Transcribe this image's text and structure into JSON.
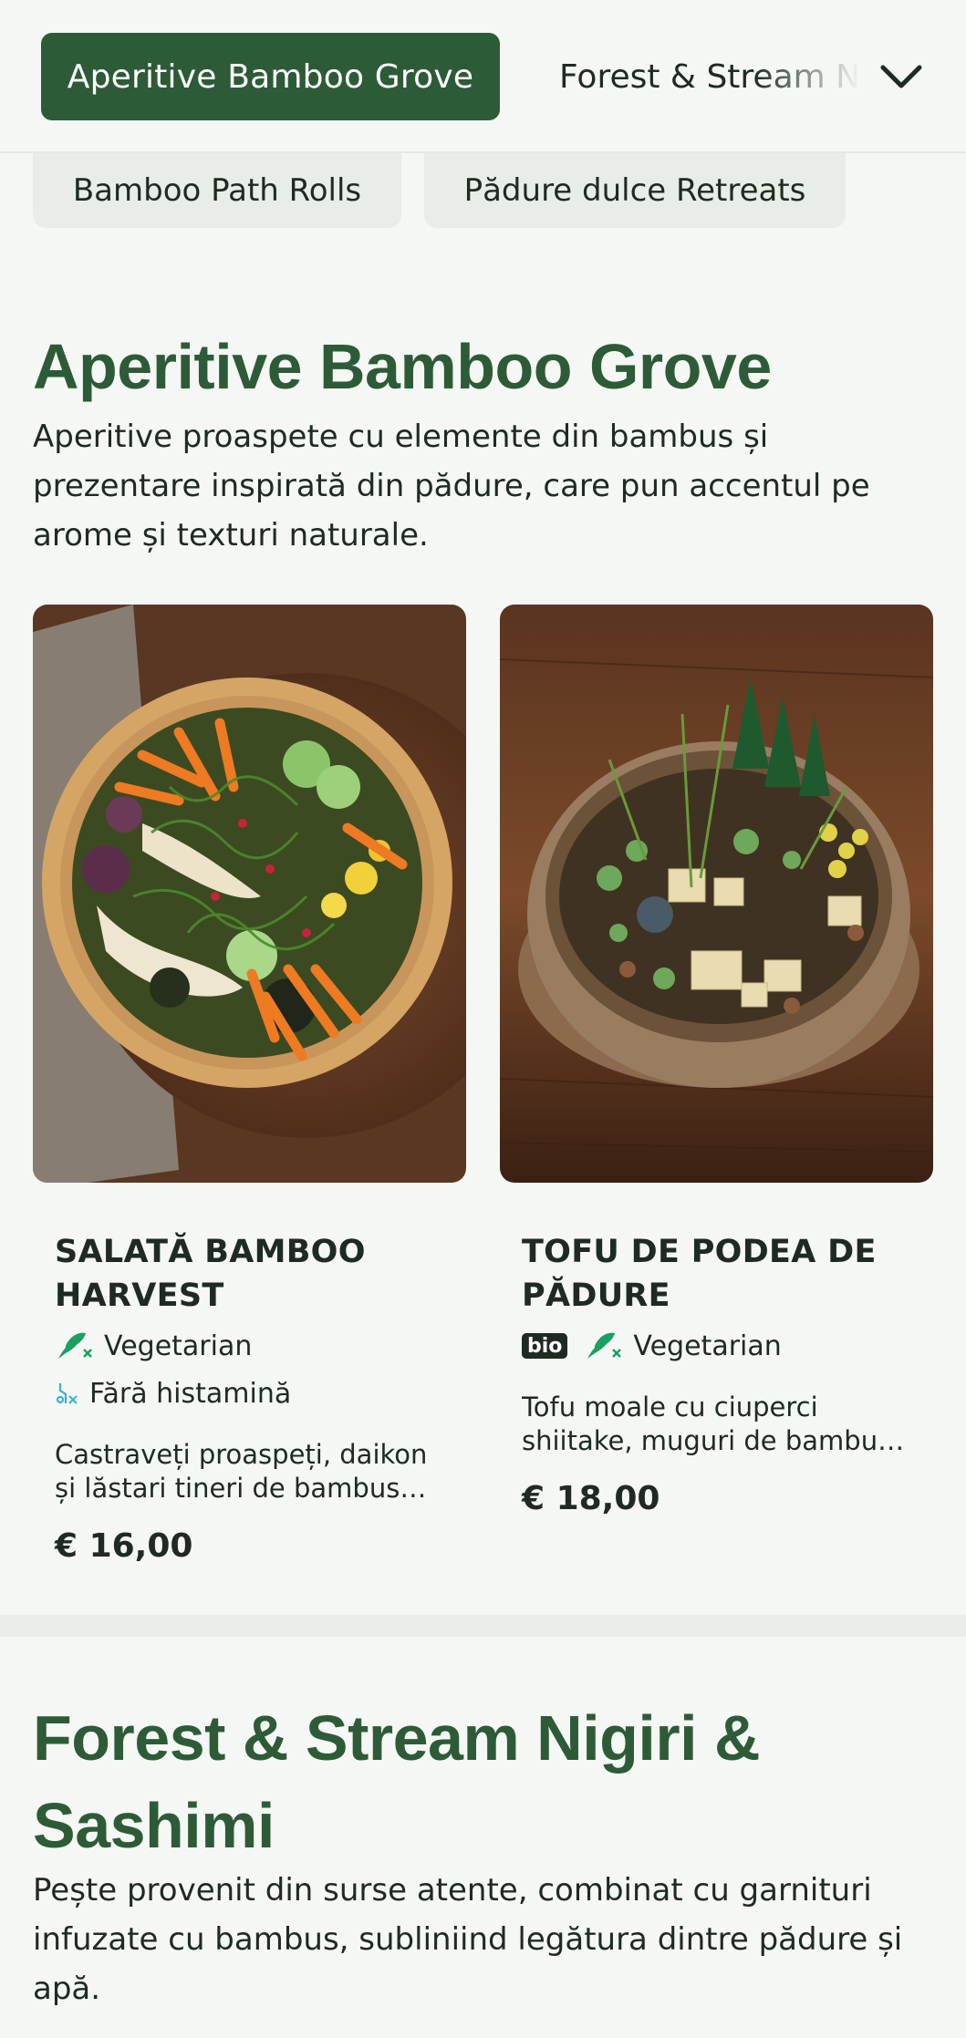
{
  "nav": {
    "active_category": "Aperitive Bamboo Grove",
    "next_category": "Forest & Stream Nigiri & Sashimi",
    "chips": [
      "Bamboo Path Rolls",
      "Pădure dulce Retreats"
    ]
  },
  "sections": [
    {
      "title": "Aperitive Bamboo Grove",
      "description": "Aperitive proaspete cu elemente din bambus și prezentare inspirată din pădure, care pun accentul pe arome și texturi naturale.",
      "items": [
        {
          "name": "SALATĂ BAMBOO HARVEST",
          "tags": [
            {
              "icon": "vegetarian-icon",
              "label": "Vegetarian"
            },
            {
              "icon": "histamine-free-icon",
              "label": "Fără histamină"
            }
          ],
          "description": "Castraveți proaspeți, daikon și lăstari tineri de bambus în...",
          "price": "€ 16,00"
        },
        {
          "name": "TOFU DE PODEA DE PĂDURE",
          "badge": "bio",
          "tags": [
            {
              "icon": "vegetarian-icon",
              "label": "Vegetarian"
            }
          ],
          "description": "Tofu moale cu ciuperci shiitake, muguri de bambus ...",
          "price": "€ 18,00"
        }
      ]
    },
    {
      "title": "Forest & Stream Nigiri & Sashimi",
      "description": "Pește provenit din surse atente, combinat cu garnituri infuzate cu bambus, subliniind legătura dintre pădure și apă."
    }
  ],
  "colors": {
    "brand_green": "#2e5b37",
    "page_bg": "#f4f7f3",
    "chip_bg": "#e8ede7",
    "tag_icon_green": "#1aa060",
    "histamine_icon": "#3ab0d8"
  }
}
